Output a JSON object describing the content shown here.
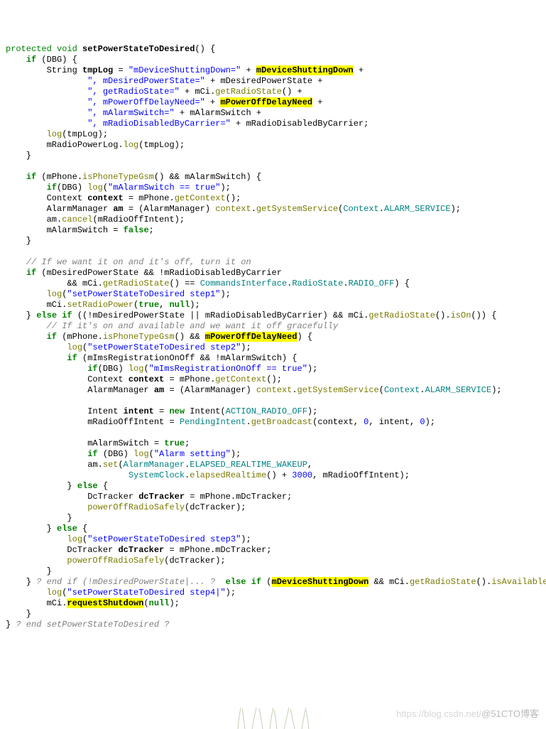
{
  "method": {
    "signature_prefix": "protected void",
    "name": "setPowerStateToDesired",
    "params": "()"
  },
  "kw": {
    "if": "if",
    "else": "else",
    "else_if": "else if",
    "new": "new",
    "true": "true",
    "false": "false",
    "null": "null",
    "void": "void",
    "protected": "protected"
  },
  "hl": {
    "mDeviceShuttingDown": "mDeviceShuttingDown",
    "mPowerOffDelayNeed": "mPowerOffDelayNeed",
    "requestShutdown": "requestShutdown"
  },
  "ids": {
    "DBG": "DBG",
    "String": "String",
    "tmpLog": "tmpLog",
    "mDesiredPowerState": "mDesiredPowerState",
    "mCi": "mCi",
    "mAlarmSwitch": "mAlarmSwitch",
    "mRadioDisabledByCarrier": "mRadioDisabledByCarrier",
    "log": "log",
    "mRadioPowerLog": "mRadioPowerLog",
    "mPhone": "mPhone",
    "Context": "Context",
    "context": "context",
    "AlarmManager": "AlarmManager",
    "am": "am",
    "mRadioOffIntent": "mRadioOffIntent",
    "mImsRegistrationOnOff": "mImsRegistrationOnOff",
    "Intent": "Intent",
    "intent": "intent",
    "ACTION_RADIO_OFF": "ACTION_RADIO_OFF",
    "PendingIntent": "PendingIntent",
    "DcTracker": "DcTracker",
    "dcTracker": "dcTracker",
    "CommandsInterface": "CommandsInterface",
    "RadioState": "RadioState",
    "RADIO_OFF": "RADIO_OFF",
    "ALARM_SERVICE": "ALARM_SERVICE",
    "ELAPSED_REALTIME_WAKEUP": "ELAPSED_REALTIME_WAKEUP",
    "SystemClock": "SystemClock",
    "mDcTracker": "mDcTracker"
  },
  "strings": {
    "s1": "\"mDeviceShuttingDown=\"",
    "s2": "\", mDesiredPowerState=\"",
    "s3": "\", getRadioState=\"",
    "s4": "\", mPowerOffDelayNeed=\"",
    "s5": "\", mAlarmSwitch=\"",
    "s6": "\", mRadioDisabledByCarrier=\"",
    "mAlarmTrue": "\"mAlarmSwitch == true\"",
    "step1": "\"setPowerStateToDesired step1\"",
    "step2": "\"setPowerStateToDesired step2\"",
    "mImsTrue": "\"mImsRegistrationOnOff == true\"",
    "alarmSetting": "\"Alarm setting\"",
    "step3": "\"setPowerStateToDesired step3\"",
    "step4": "\"setPowerStateToDesired step4|\""
  },
  "comments": {
    "c1": "// If we want it on and it's off, turn it on",
    "c2": "// If it's on and available and we want it off gracefully",
    "c3": "? end if (!mDesiredPowerState|... ?",
    "c4": "? end setPowerStateToDesired ?"
  },
  "nums": {
    "zero": "0",
    "three_thousand": "3000"
  },
  "watermark_left": "https://blog.csdn.net/",
  "watermark_right": "@51CTO博客"
}
